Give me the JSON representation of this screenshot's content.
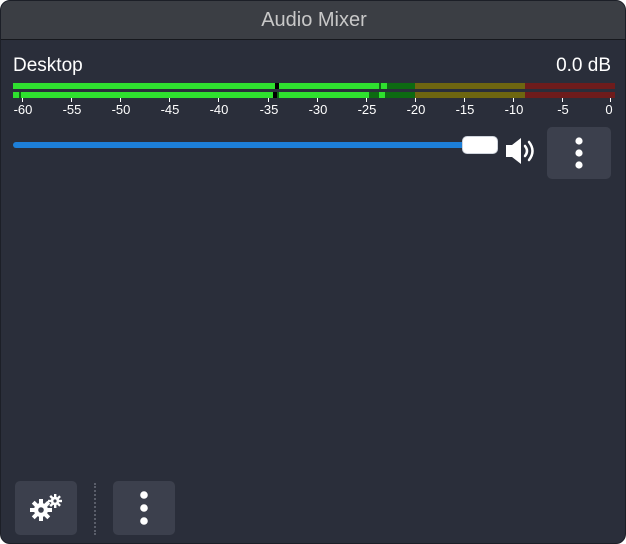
{
  "window": {
    "title": "Audio Mixer"
  },
  "source": {
    "name": "Desktop",
    "volume_db": "0.0 dB",
    "volume_fraction": 0.94,
    "muted": false,
    "meter_level_db": -34,
    "meter_peak_db": -23
  },
  "scale": {
    "ticks": [
      "-60",
      "-55",
      "-50",
      "-45",
      "-40",
      "-35",
      "-30",
      "-25",
      "-20",
      "-15",
      "-10",
      "-5",
      "0"
    ]
  },
  "icons": {
    "volume": "speaker-icon",
    "source_menu": "vertical-dots-icon",
    "settings": "gears-icon",
    "mixer_menu": "vertical-dots-icon"
  },
  "colors": {
    "background": "#2a2e3a",
    "meter_green": "#2fe02f",
    "meter_yellow": "#c8b400",
    "meter_red": "#cc2a2a",
    "slider": "#1d7fd8"
  }
}
